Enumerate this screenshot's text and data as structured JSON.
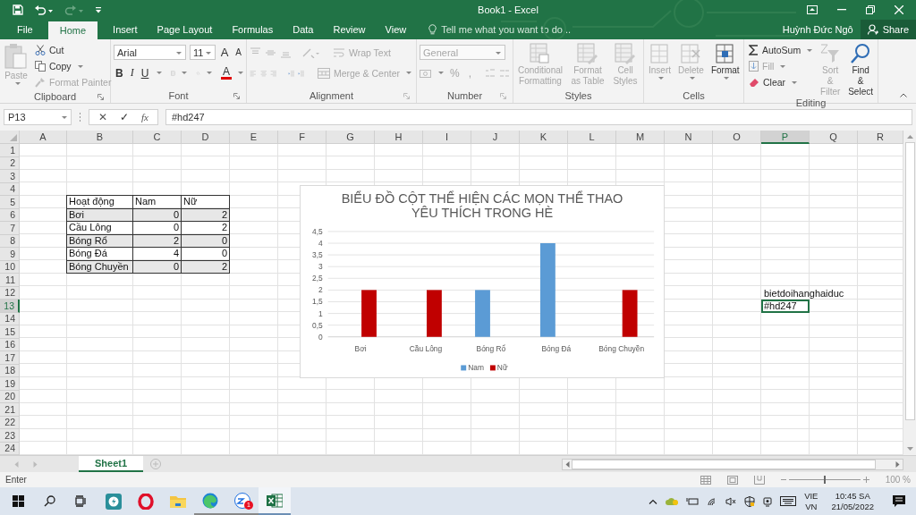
{
  "title_bar": {
    "title": "Book1 - Excel"
  },
  "menu_tabs": [
    {
      "label": "File",
      "selected": false
    },
    {
      "label": "Home",
      "selected": true
    },
    {
      "label": "Insert",
      "selected": false
    },
    {
      "label": "Page Layout",
      "selected": false
    },
    {
      "label": "Formulas",
      "selected": false
    },
    {
      "label": "Data",
      "selected": false
    },
    {
      "label": "Review",
      "selected": false
    },
    {
      "label": "View",
      "selected": false
    }
  ],
  "tell_me": {
    "placeholder": "Tell me what you want to do..."
  },
  "account": {
    "user": "Huỳnh Đức Ngô",
    "share": "Share"
  },
  "ribbon": [
    {
      "kind": "clipboard",
      "label": "Clipboard",
      "buttons": [
        {
          "label": "Paste",
          "disabled": true
        },
        {
          "label": "Cut",
          "disabled": false
        },
        {
          "label": "Copy",
          "disabled": false
        },
        {
          "label": "Format Painter",
          "disabled": true
        }
      ]
    },
    {
      "kind": "font",
      "label": "Font",
      "font_name": "Arial",
      "font_size": "11",
      "buttons": [
        {
          "kind": "grow",
          "label": "A"
        },
        {
          "kind": "shrink",
          "label": "A"
        },
        {
          "kind": "bold",
          "label": "B"
        },
        {
          "kind": "italic",
          "label": "I"
        },
        {
          "kind": "underline",
          "label": "U"
        },
        {
          "kind": "color",
          "label": "A"
        }
      ]
    },
    {
      "kind": "alignment",
      "label": "Alignment",
      "buttons": [
        {
          "label": "Wrap Text",
          "disabled": true
        },
        {
          "label": "Merge & Center",
          "disabled": true
        }
      ]
    },
    {
      "kind": "number",
      "label": "Number",
      "format": "General",
      "buttons": [
        {
          "label": "%",
          "disabled": true
        },
        {
          "label": ",",
          "disabled": true
        }
      ]
    },
    {
      "kind": "styles",
      "label": "Styles",
      "buttons": [
        {
          "label": "Conditional Formatting",
          "disabled": true
        },
        {
          "label": "Format as Table",
          "disabled": true
        },
        {
          "label": "Cell Styles",
          "disabled": true
        }
      ]
    },
    {
      "kind": "cells",
      "label": "Cells",
      "buttons": [
        {
          "label": "Insert",
          "disabled": true
        },
        {
          "label": "Delete",
          "disabled": true
        },
        {
          "label": "Format",
          "disabled": false
        }
      ]
    },
    {
      "kind": "editing",
      "label": "Editing",
      "buttons": [
        {
          "label": "AutoSum",
          "disabled": false
        },
        {
          "label": "Fill",
          "disabled": true
        },
        {
          "label": "Clear",
          "disabled": false
        },
        {
          "label": "Sort & Filter",
          "disabled": true
        },
        {
          "label": "Find & Select",
          "disabled": false
        }
      ]
    }
  ],
  "formula_bar": {
    "name_box": "P13",
    "cancel": "✕",
    "enter": "✓",
    "fx": "fx",
    "content": "#hd247"
  },
  "sheet": {
    "columns": [
      "A",
      "B",
      "C",
      "D",
      "E",
      "F",
      "G",
      "H",
      "I",
      "J",
      "K",
      "L",
      "M",
      "N",
      "O",
      "P",
      "Q",
      "R"
    ],
    "rows": [
      "1",
      "2",
      "3",
      "4",
      "5",
      "6",
      "7",
      "8",
      "9",
      "10",
      "11",
      "12",
      "13",
      "14",
      "15",
      "16",
      "17",
      "18",
      "19",
      "20",
      "21",
      "22",
      "23",
      "24"
    ],
    "data_table": {
      "header": [
        "Hoạt động",
        "Nam",
        "Nữ"
      ],
      "rows": [
        [
          "Bơi",
          "0",
          "2"
        ],
        [
          "Cầu Lông",
          "0",
          "2"
        ],
        [
          "Bóng Rổ",
          "2",
          "0"
        ],
        [
          "Bóng Đá",
          "4",
          "0"
        ],
        [
          "Bóng Chuyền",
          "0",
          "2"
        ]
      ]
    },
    "notes": [
      {
        "text": "bietdoihanghaiduc",
        "selected": false
      },
      {
        "text": "#hd247",
        "selected": true
      }
    ],
    "chart_data": {
      "type": "bar",
      "title": "BIỂU ĐỒ CỘT THỂ HIỆN CÁC MỌN THỂ THAO YÊU THÍCH TRONG HÈ",
      "categories": [
        "Bơi",
        "Cầu Lông",
        "Bóng Rổ",
        "Bóng Đá",
        "Bóng Chuyền"
      ],
      "series": [
        {
          "name": "Nam",
          "color": "#5b9bd5",
          "values": [
            0,
            0,
            2,
            4,
            0
          ]
        },
        {
          "name": "Nữ",
          "color": "#c00000",
          "values": [
            2,
            2,
            0,
            0,
            2
          ]
        }
      ],
      "grid": true,
      "legend": true,
      "ylim": [
        0,
        4.5
      ],
      "yticks": [
        {
          "value": 0,
          "label": "0"
        },
        {
          "value": 0.5,
          "label": "0,5"
        },
        {
          "value": 1,
          "label": "1"
        },
        {
          "value": 1.5,
          "label": "1,5"
        },
        {
          "value": 2,
          "label": "2"
        },
        {
          "value": 2.5,
          "label": "2,5"
        },
        {
          "value": 3,
          "label": "3"
        },
        {
          "value": 3.5,
          "label": "3,5"
        },
        {
          "value": 4,
          "label": "4"
        },
        {
          "value": 4.5,
          "label": "4,5"
        }
      ]
    }
  },
  "sheet_tabs": [
    {
      "label": "Sheet1",
      "selected": true
    }
  ],
  "status_bar": {
    "mode": "Enter",
    "zoom": {
      "reading": "100 %",
      "level": 0.5
    }
  },
  "taskbar": {
    "apps": [
      {
        "kind": "store",
        "running": false,
        "selected": false
      },
      {
        "kind": "opera",
        "running": false,
        "selected": false
      },
      {
        "kind": "explorer",
        "running": false,
        "selected": false
      },
      {
        "kind": "edge",
        "running": true,
        "selected": false
      },
      {
        "kind": "zalo",
        "running": true,
        "selected": false,
        "badge": "1"
      },
      {
        "kind": "excel",
        "running": true,
        "selected": true
      }
    ],
    "tray": {
      "language": "VIE",
      "region": "VN",
      "time": "10:45 SA",
      "date": "21/05/2022"
    }
  }
}
